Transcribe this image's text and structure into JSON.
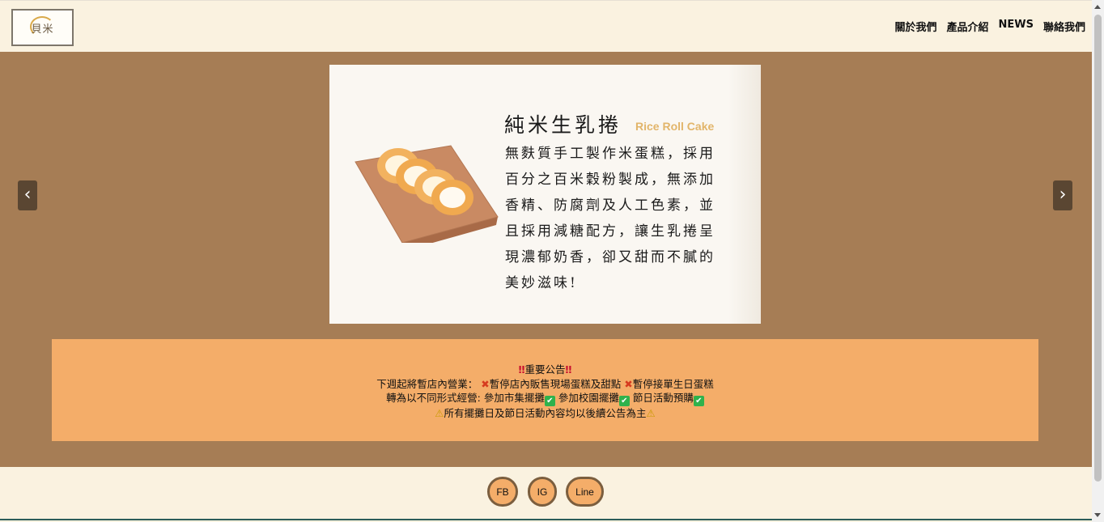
{
  "header": {
    "logo_text": "貝米",
    "nav": [
      {
        "label": "關於我們"
      },
      {
        "label": "產品介紹"
      },
      {
        "label": "NEWS"
      },
      {
        "label": "聯絡我們"
      }
    ]
  },
  "carousel": {
    "prev_label": "‹",
    "next_label": "›",
    "slide": {
      "title": "純米生乳捲",
      "subtitle_en": "Rice Roll Cake",
      "description": "無麩質手工製作米蛋糕，採用百分之百米穀粉製成，無添加香精、防腐劑及人工色素，並且採用減糖配方，讓生乳捲呈現濃郁奶香，卻又甜而不膩的美妙滋味!"
    }
  },
  "notice": {
    "title": "重要公告",
    "line1_prefix": "下週起將暫店內營業：",
    "line1_item1": "暫停店內販售現場蛋糕及甜點",
    "line1_item2": "暫停接單生日蛋糕",
    "line2_prefix": "轉為以不同形式經營: ",
    "line2_item1": "參加市集擺攤",
    "line2_item2": "參加校園擺攤",
    "line2_item3": "節日活動預購",
    "line3": "所有擺攤日及節日活動內容均以後續公告為主",
    "icon_exclamation": "‼",
    "icon_cross": "✖",
    "icon_check": "✔",
    "icon_warning": "⚠"
  },
  "footer": {
    "social": [
      {
        "label": "FB"
      },
      {
        "label": "IG"
      },
      {
        "label": "Line"
      }
    ]
  },
  "colors": {
    "header_bg": "#faf2e0",
    "band_bg": "#a67d55",
    "notice_bg": "#f4ad69",
    "arrow_bg": "#5a4632",
    "accent_en": "#e2b56a"
  }
}
